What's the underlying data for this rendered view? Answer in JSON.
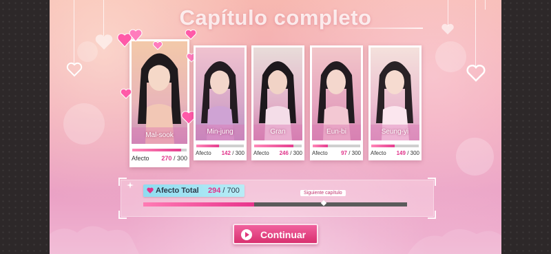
{
  "screen": {
    "title": "Capítulo completo"
  },
  "cards": [
    {
      "name": "Mal-sook",
      "affection_label": "Afecto",
      "affection": "270",
      "max": "/ 300",
      "fraction": 0.9,
      "tone": [
        "#f3c9a9",
        "#d9a7b6",
        "#c98fb8"
      ]
    },
    {
      "name": "Min-jung",
      "affection_label": "Afecto",
      "affection": "142",
      "max": "/ 300",
      "fraction": 0.473,
      "tone": [
        "#f0c2cf",
        "#d7a8c8",
        "#b990c3"
      ]
    },
    {
      "name": "Gran",
      "affection_label": "Afecto",
      "affection": "246",
      "max": "/ 300",
      "fraction": 0.82,
      "tone": [
        "#e8dcd9",
        "#e2b2c9",
        "#d183b0"
      ]
    },
    {
      "name": "Eun-bi",
      "affection_label": "Afecto",
      "affection": "97",
      "max": "/ 300",
      "fraction": 0.323,
      "tone": [
        "#f2c6c9",
        "#e6a5bf",
        "#d488b1"
      ]
    },
    {
      "name": "Seung-yi",
      "affection_label": "Afecto",
      "affection": "149",
      "max": "/ 300",
      "fraction": 0.497,
      "tone": [
        "#f4e1dc",
        "#ecbfd0",
        "#dc9cc2"
      ]
    }
  ],
  "total": {
    "label": "Afecto Total",
    "value": "294",
    "max": "/ 700",
    "fraction": 0.42,
    "next_chapter_label": "Siguiente capítulo",
    "next_chapter_fraction": 0.685
  },
  "continue_button": {
    "label": "Continuar"
  },
  "colors": {
    "accent": "#e0338a",
    "tag": "#8fdcf0"
  }
}
